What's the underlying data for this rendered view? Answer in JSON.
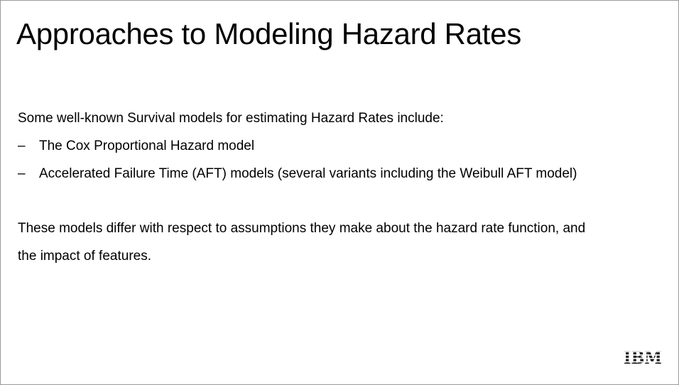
{
  "slide": {
    "title": "Approaches to Modeling Hazard Rates",
    "intro": "Some well-known Survival models for estimating Hazard Rates include:",
    "bullets": [
      {
        "marker": "–",
        "text": "The Cox Proportional Hazard model"
      },
      {
        "marker": "–",
        "text": "Accelerated Failure Time (AFT) models (several variants including the Weibull AFT model)"
      }
    ],
    "paragraph_line1": "These models differ with respect to assumptions they make about the hazard rate function, and",
    "paragraph_line2": "the impact of features."
  },
  "logo": {
    "text": "IBM",
    "color": "#1a1a1a"
  }
}
